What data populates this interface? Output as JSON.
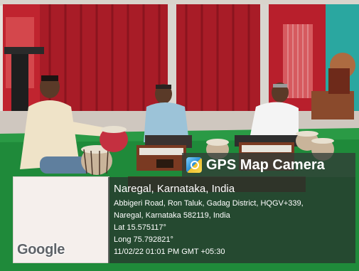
{
  "overlay": {
    "app_name": "GPS Map Camera",
    "location_title": "Naregal, Karnataka, India",
    "address_line_1": "Abbigeri Road, Ron Taluk, Gadag District, HQGV+339,",
    "address_line_2": "Naregal, Karnataka 582119, India",
    "latitude": "Lat 15.575117°",
    "longitude": "Long 75.792821°",
    "timestamp": "11/02/22 01:01 PM GMT +05:30",
    "app_icon": "camera-pin-icon"
  },
  "map": {
    "provider_label": "Google"
  },
  "photo": {
    "subject": "three men playing harmonium and tabla on a green mat in a hall with red curtains",
    "colors": {
      "curtain": "#b01e2a",
      "wall": "#e6e2dc",
      "floor_mat": "#1f8a3a",
      "teal_wall": "#2aa7a0"
    }
  }
}
